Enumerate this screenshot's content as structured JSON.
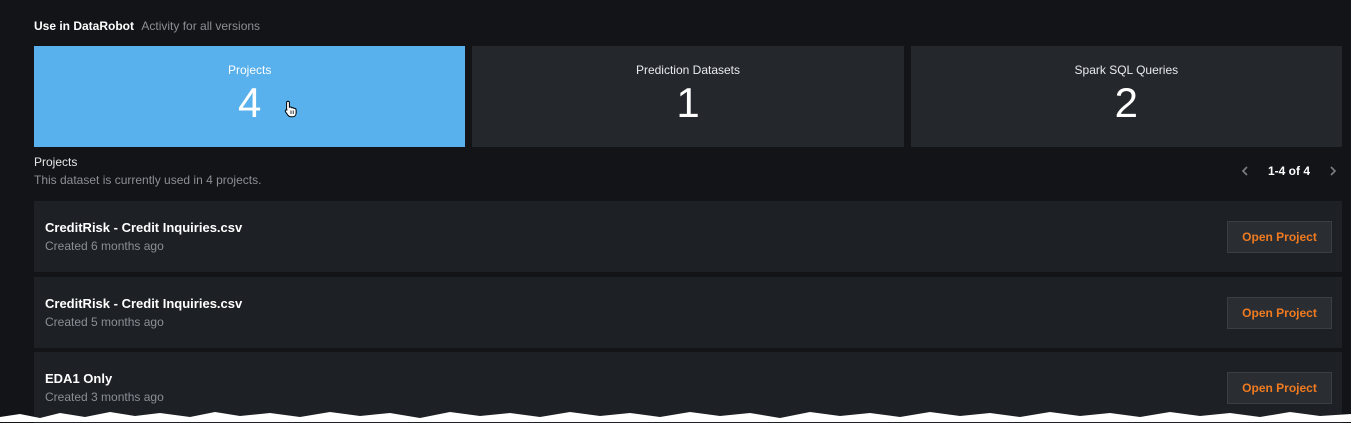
{
  "header": {
    "title": "Use in DataRobot",
    "subtitle": "Activity for all versions"
  },
  "tiles": [
    {
      "label": "Projects",
      "count": "4"
    },
    {
      "label": "Prediction Datasets",
      "count": "1"
    },
    {
      "label": "Spark SQL Queries",
      "count": "2"
    }
  ],
  "section": {
    "title": "Projects",
    "description": "This dataset is currently used in 4 projects."
  },
  "pager": {
    "range": "1-4 of 4"
  },
  "rows": [
    {
      "name": "CreditRisk - Credit Inquiries.csv",
      "created": "Created 6 months ago",
      "button": "Open Project"
    },
    {
      "name": "CreditRisk - Credit Inquiries.csv",
      "created": "Created 5 months ago",
      "button": "Open Project"
    },
    {
      "name": "EDA1 Only",
      "created": "Created 3 months ago",
      "button": "Open Project"
    }
  ],
  "colors": {
    "background": "#121417",
    "active_tile": "#58b0ec",
    "tile": "#24282d",
    "row": "#1d2024",
    "accent_button_text": "#f07a1f"
  },
  "icons": {
    "cursor": "hand-pointer-icon",
    "prev": "chevron-left-icon",
    "next": "chevron-right-icon"
  }
}
